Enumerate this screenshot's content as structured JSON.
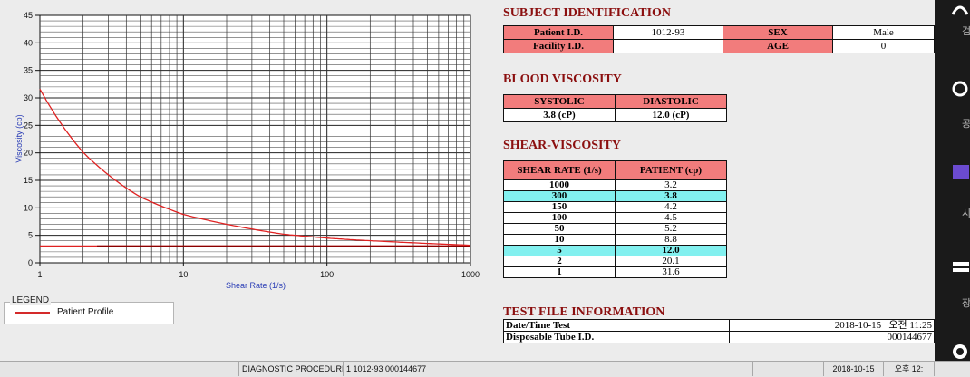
{
  "chart_data": {
    "type": "line",
    "x_scale": "log",
    "xlim": [
      1,
      1000
    ],
    "ylim": [
      0,
      45
    ],
    "xlabel": "Shear Rate (1/s)",
    "ylabel": "Viscosity (cp)",
    "x_ticks": [
      "1",
      "10",
      "100",
      "1000"
    ],
    "y_ticks": [
      "0",
      "5",
      "10",
      "15",
      "20",
      "25",
      "30",
      "35",
      "40",
      "45"
    ],
    "grid": true,
    "series": [
      {
        "name": "Patient Profile",
        "color": "#e02222",
        "x": [
          1,
          2,
          5,
          10,
          50,
          100,
          150,
          300,
          1000
        ],
        "y": [
          31.6,
          20.1,
          12.0,
          8.8,
          5.2,
          4.5,
          4.2,
          3.8,
          3.2
        ]
      }
    ],
    "reference_lines": [
      {
        "color": "#e02222",
        "y": 3.0,
        "x": [
          1,
          1000
        ]
      },
      {
        "color": "#8b0000",
        "y": 3.0,
        "x": [
          2.5,
          1000
        ]
      }
    ]
  },
  "legend": {
    "title": "LEGEND",
    "label": "Patient Profile"
  },
  "subject": {
    "title": "SUBJECT IDENTIFICATION",
    "patient_id_label": "Patient I.D.",
    "patient_id": "1012-93",
    "sex_label": "SEX",
    "sex": "Male",
    "facility_label": "Facility I.D.",
    "facility": "",
    "age_label": "AGE",
    "age": "0"
  },
  "blood_viscosity": {
    "title": "BLOOD VISCOSITY",
    "systolic_label": "SYSTOLIC",
    "diastolic_label": "DIASTOLIC",
    "systolic": "3.8 (cP)",
    "diastolic": "12.0 (cP)"
  },
  "shear_viscosity": {
    "title": "SHEAR-VISCOSITY",
    "col1": "SHEAR RATE (1/s)",
    "col2": "PATIENT (cp)",
    "rows": [
      {
        "rate": "1000",
        "value": "3.2",
        "highlight": false
      },
      {
        "rate": "300",
        "value": "3.8",
        "highlight": true
      },
      {
        "rate": "150",
        "value": "4.2",
        "highlight": false
      },
      {
        "rate": "100",
        "value": "4.5",
        "highlight": false
      },
      {
        "rate": "50",
        "value": "5.2",
        "highlight": false
      },
      {
        "rate": "10",
        "value": "8.8",
        "highlight": false
      },
      {
        "rate": "5",
        "value": "12.0",
        "highlight": true
      },
      {
        "rate": "2",
        "value": "20.1",
        "highlight": false
      },
      {
        "rate": "1",
        "value": "31.6",
        "highlight": false
      }
    ]
  },
  "test_file": {
    "title": "TEST FILE INFORMATION",
    "datetime_label": "Date/Time Test",
    "datetime": "2018-10-15   오전 11:25",
    "tube_label": "Disposable Tube I.D.",
    "tube": "000144677"
  },
  "statusbar": {
    "procedures": "DIAGNOSTIC PROCEDURES",
    "record": "1  1012-93  000144677",
    "date": "2018-10-15",
    "time": "오후 12:"
  },
  "side_panel": {
    "labels": [
      "검",
      "공",
      "시",
      "장"
    ]
  },
  "colors": {
    "header_red": "#f27c7c",
    "highlight_cyan": "#82f0ef",
    "section_title": "#8b0f0f"
  }
}
